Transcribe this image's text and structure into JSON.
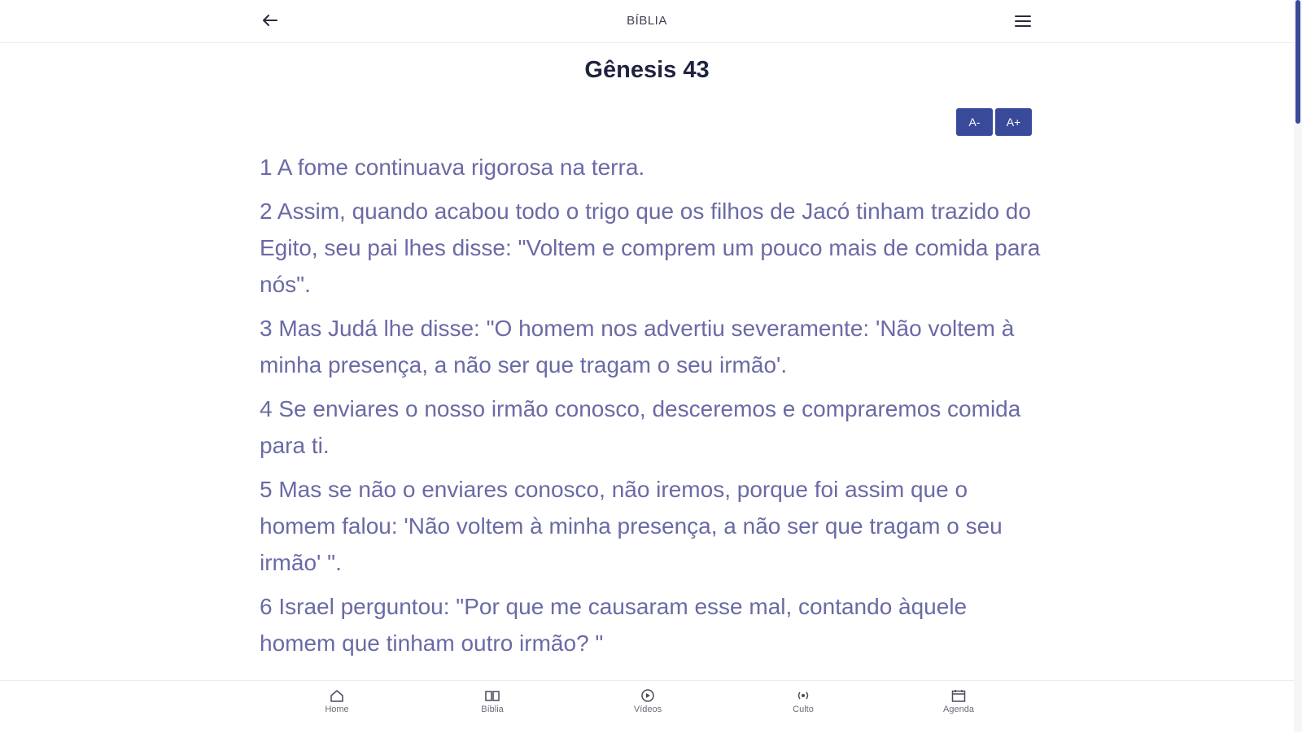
{
  "header": {
    "title": "BÍBLIA",
    "back_icon": "arrow-left-icon",
    "menu_icon": "hamburger-menu-icon"
  },
  "chapter": {
    "title": "Gênesis 43"
  },
  "font_controls": {
    "decrease_label": "A-",
    "increase_label": "A+"
  },
  "verses": [
    "1 A fome continuava rigorosa na terra.",
    "2 Assim, quando acabou todo o trigo que os filhos de Jacó tinham trazido do Egito, seu pai lhes disse: \"Voltem e comprem um pouco mais de comida para nós\".",
    "3 Mas Judá lhe disse: \"O homem nos advertiu severamente: 'Não voltem à minha presença, a não ser que tragam o seu irmão'.",
    "4 Se enviares o nosso irmão conosco, desceremos e compraremos comida para ti.",
    "5 Mas se não o enviares conosco, não iremos, porque foi assim que o homem falou: 'Não voltem à minha presença, a não ser que tragam o seu irmão' \".",
    "6 Israel perguntou: \"Por que me causaram esse mal, contando àquele homem que tinham outro irmão? \""
  ],
  "bottom_nav": {
    "items": [
      {
        "label": "Home",
        "icon": "home-icon"
      },
      {
        "label": "Bíblia",
        "icon": "book-icon"
      },
      {
        "label": "Vídeos",
        "icon": "video-icon"
      },
      {
        "label": "Culto",
        "icon": "broadcast-icon"
      },
      {
        "label": "Agenda",
        "icon": "calendar-icon"
      }
    ]
  },
  "colors": {
    "accent": "#3a4a9a",
    "verse_text": "#6a6aa6",
    "title_text": "#1f2340"
  }
}
